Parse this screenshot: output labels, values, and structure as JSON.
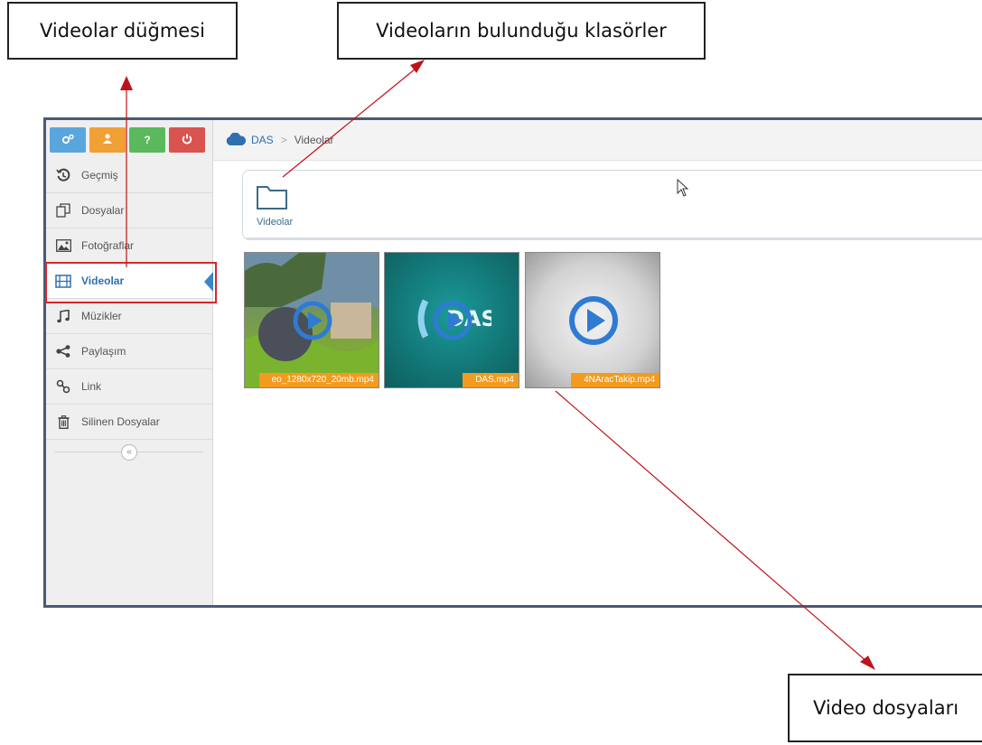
{
  "callouts": {
    "videos_button": "Videolar düğmesi",
    "folders": "Videoların bulunduğu klasörler",
    "video_files": "Video dosyaları"
  },
  "top_buttons": [
    {
      "icon": "settings-icon",
      "color": "#5aa6dc"
    },
    {
      "icon": "user-icon",
      "color": "#f0a035"
    },
    {
      "icon": "help-icon",
      "color": "#5bb85c"
    },
    {
      "icon": "power-icon",
      "color": "#d9534f"
    }
  ],
  "sidebar": {
    "items": [
      {
        "label": "Geçmiş",
        "icon": "history-icon"
      },
      {
        "label": "Dosyalar",
        "icon": "files-icon"
      },
      {
        "label": "Fotoğraflar",
        "icon": "photo-icon"
      },
      {
        "label": "Videolar",
        "icon": "film-icon",
        "active": true
      },
      {
        "label": "Müzikler",
        "icon": "music-icon"
      },
      {
        "label": "Paylaşım",
        "icon": "share-icon"
      },
      {
        "label": "Link",
        "icon": "link-icon"
      },
      {
        "label": "Silinen Dosyalar",
        "icon": "trash-icon"
      }
    ],
    "collapse_glyph": "«"
  },
  "breadcrumb": {
    "home": "DAS",
    "separator": ">",
    "current": "Videolar"
  },
  "folders": [
    {
      "label": "Videolar"
    }
  ],
  "videos": [
    {
      "name": "eo_1280x720_20mb.mp4"
    },
    {
      "name": "DAS.mp4"
    },
    {
      "name": "4NAracTakip.mp4"
    }
  ],
  "colors": {
    "highlight_red": "#d8272d",
    "arrow_red": "#c0121b",
    "accent_blue": "#2f6fb0",
    "label_orange": "#f29b1e"
  }
}
